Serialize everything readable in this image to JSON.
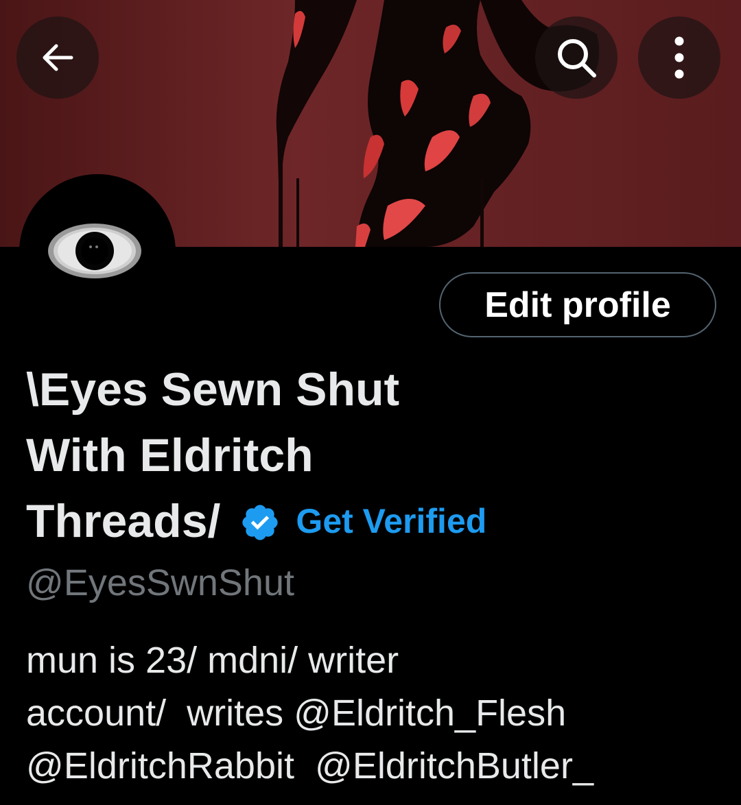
{
  "header": {
    "back_icon": "arrow-left-icon",
    "search_icon": "search-icon",
    "more_icon": "more-vertical-icon"
  },
  "profile": {
    "edit_button_label": "Edit profile",
    "name_lines": [
      "\\Eyes Sewn Shut",
      "With Eldritch",
      "Threads/"
    ],
    "verified_icon": "verified-badge-icon",
    "get_verified_label": "Get Verified",
    "handle": "@EyesSwnShut",
    "bio": {
      "line1": "mun is 23/ mdni/ writer",
      "line2_prefix": "account/  writes ",
      "mention1": "@Eldritch_Flesh",
      "mention2": "@EldritchRabbit",
      "line3_sep": "  ",
      "mention3": "@EldritchButler_"
    }
  },
  "colors": {
    "background": "#000000",
    "text_primary": "#e7e9ea",
    "text_secondary": "#71767b",
    "accent": "#1d9bf0",
    "banner_red": "#6b2224",
    "button_border": "#536471"
  }
}
